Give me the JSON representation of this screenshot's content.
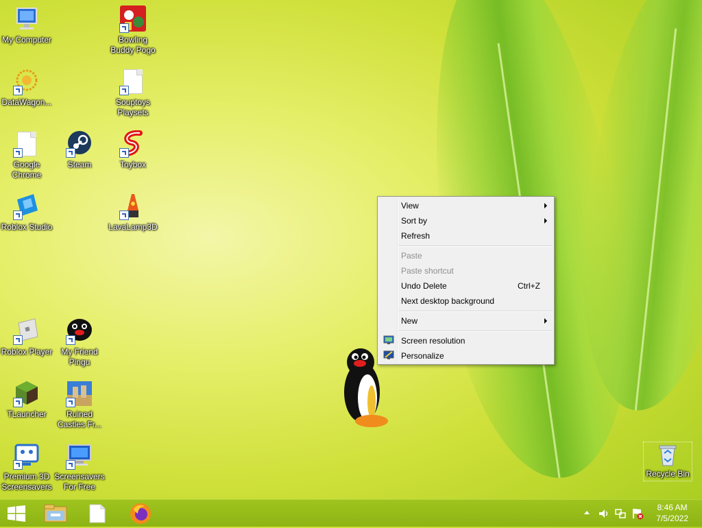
{
  "desktop": {
    "icons": [
      {
        "label": "My Computer",
        "icon": "computer-icon"
      },
      {
        "label": "Bowling Buddy Pogo",
        "icon": "bowling-icon"
      },
      {
        "label": "DataWagon...",
        "icon": "datawagon-icon"
      },
      {
        "label": "Souptoys Playsets",
        "icon": "document-icon"
      },
      {
        "label": "Google Chrome",
        "icon": "document-icon"
      },
      {
        "label": "Steam",
        "icon": "steam-icon"
      },
      {
        "label": "Toybox",
        "icon": "toybox-icon"
      },
      {
        "label": "Roblox Studio",
        "icon": "roblox-studio-icon"
      },
      {
        "label": "LavaLamp3D",
        "icon": "lava-lamp-icon"
      },
      {
        "label": "Roblox Player",
        "icon": "roblox-player-icon"
      },
      {
        "label": "My Friend Pingu",
        "icon": "pingu-icon"
      },
      {
        "label": "TLauncher",
        "icon": "tlauncher-icon"
      },
      {
        "label": "Ruined Castles Fr...",
        "icon": "castle-icon"
      },
      {
        "label": "Premium 3D Screensavers",
        "icon": "screensaver-icon"
      },
      {
        "label": "Screensavers For Free",
        "icon": "monitor-icon"
      },
      {
        "label": "Recycle Bin",
        "icon": "recycle-bin-icon"
      }
    ]
  },
  "context_menu": {
    "items": [
      {
        "label": "View",
        "submenu": true,
        "disabled": false
      },
      {
        "label": "Sort by",
        "submenu": true,
        "disabled": false
      },
      {
        "label": "Refresh",
        "submenu": false,
        "disabled": false
      },
      {
        "label": "Paste",
        "submenu": false,
        "disabled": true
      },
      {
        "label": "Paste shortcut",
        "submenu": false,
        "disabled": true
      },
      {
        "label": "Undo Delete",
        "shortcut": "Ctrl+Z",
        "submenu": false,
        "disabled": false
      },
      {
        "label": "Next desktop background",
        "submenu": false,
        "disabled": false
      },
      {
        "label": "New",
        "submenu": true,
        "disabled": false
      },
      {
        "label": "Screen resolution",
        "icon": "screen-resolution-icon",
        "submenu": false,
        "disabled": false
      },
      {
        "label": "Personalize",
        "icon": "personalize-icon",
        "submenu": false,
        "disabled": false
      }
    ]
  },
  "taskbar": {
    "pinned": [
      {
        "name": "start-button",
        "icon": "windows-logo-icon"
      },
      {
        "name": "file-explorer",
        "icon": "folder-icon"
      },
      {
        "name": "notepad",
        "icon": "document-icon"
      },
      {
        "name": "firefox",
        "icon": "firefox-icon"
      }
    ],
    "tray": {
      "time": "8:46 AM",
      "date": "7/5/2022"
    }
  },
  "colors": {
    "taskbar": "#8db414",
    "menu_bg": "#f0f0f0",
    "disabled_text": "#8d8d8d"
  }
}
